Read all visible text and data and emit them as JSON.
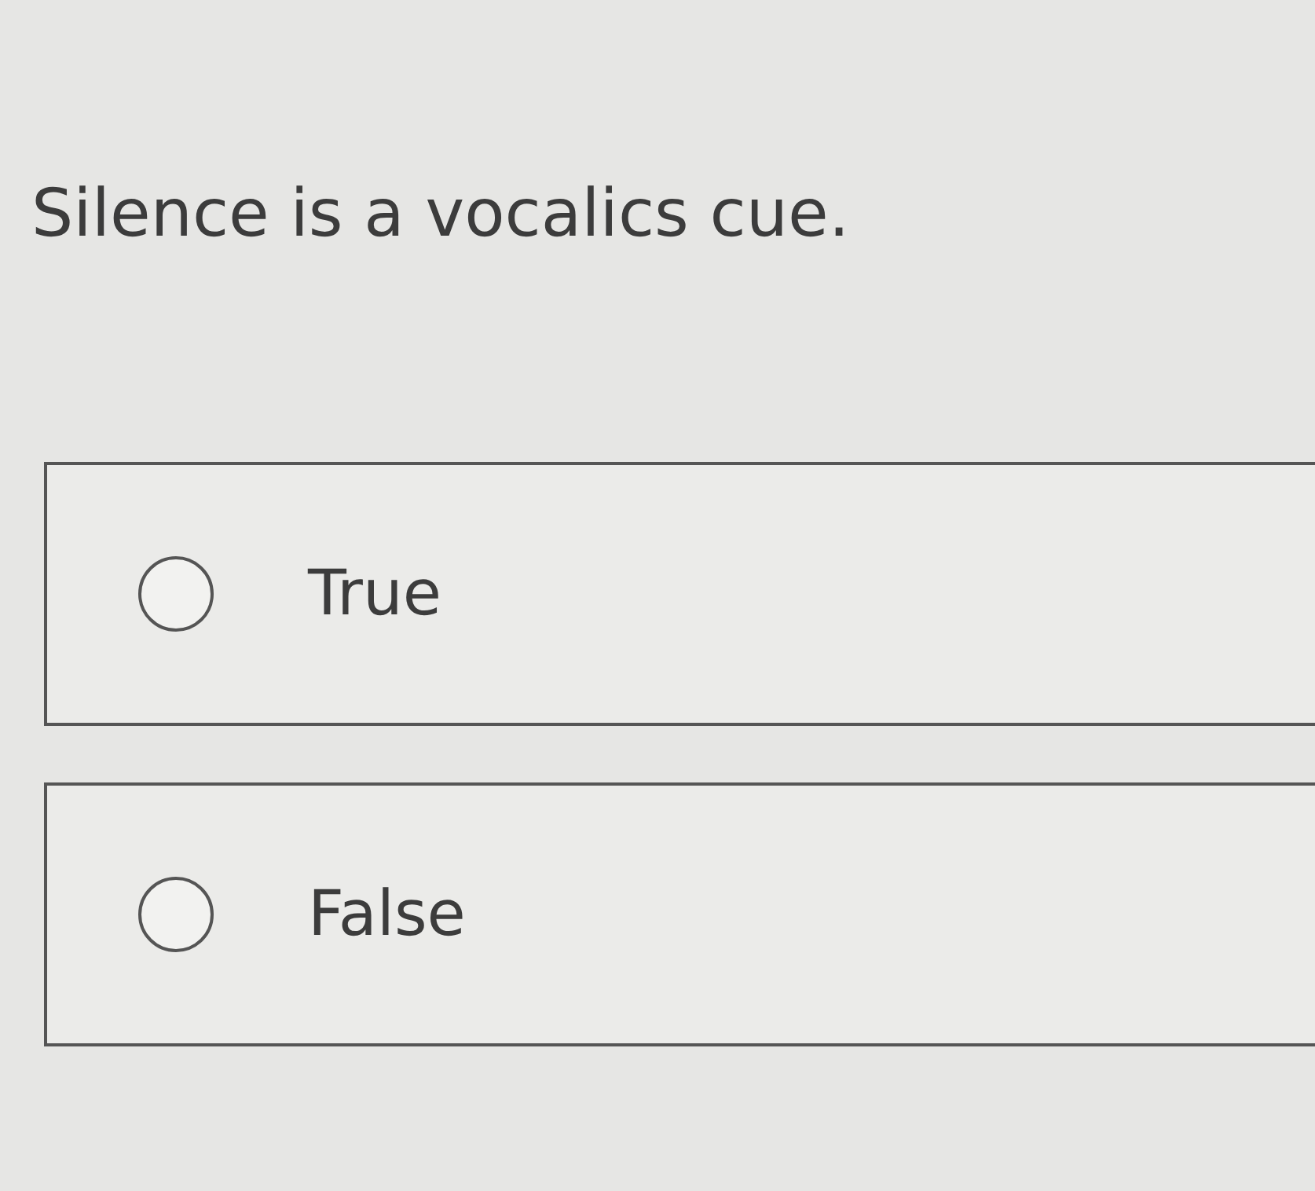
{
  "question": "Silence is a vocalics cue.",
  "options": [
    {
      "label": "True",
      "selected": false
    },
    {
      "label": "False",
      "selected": false
    }
  ]
}
